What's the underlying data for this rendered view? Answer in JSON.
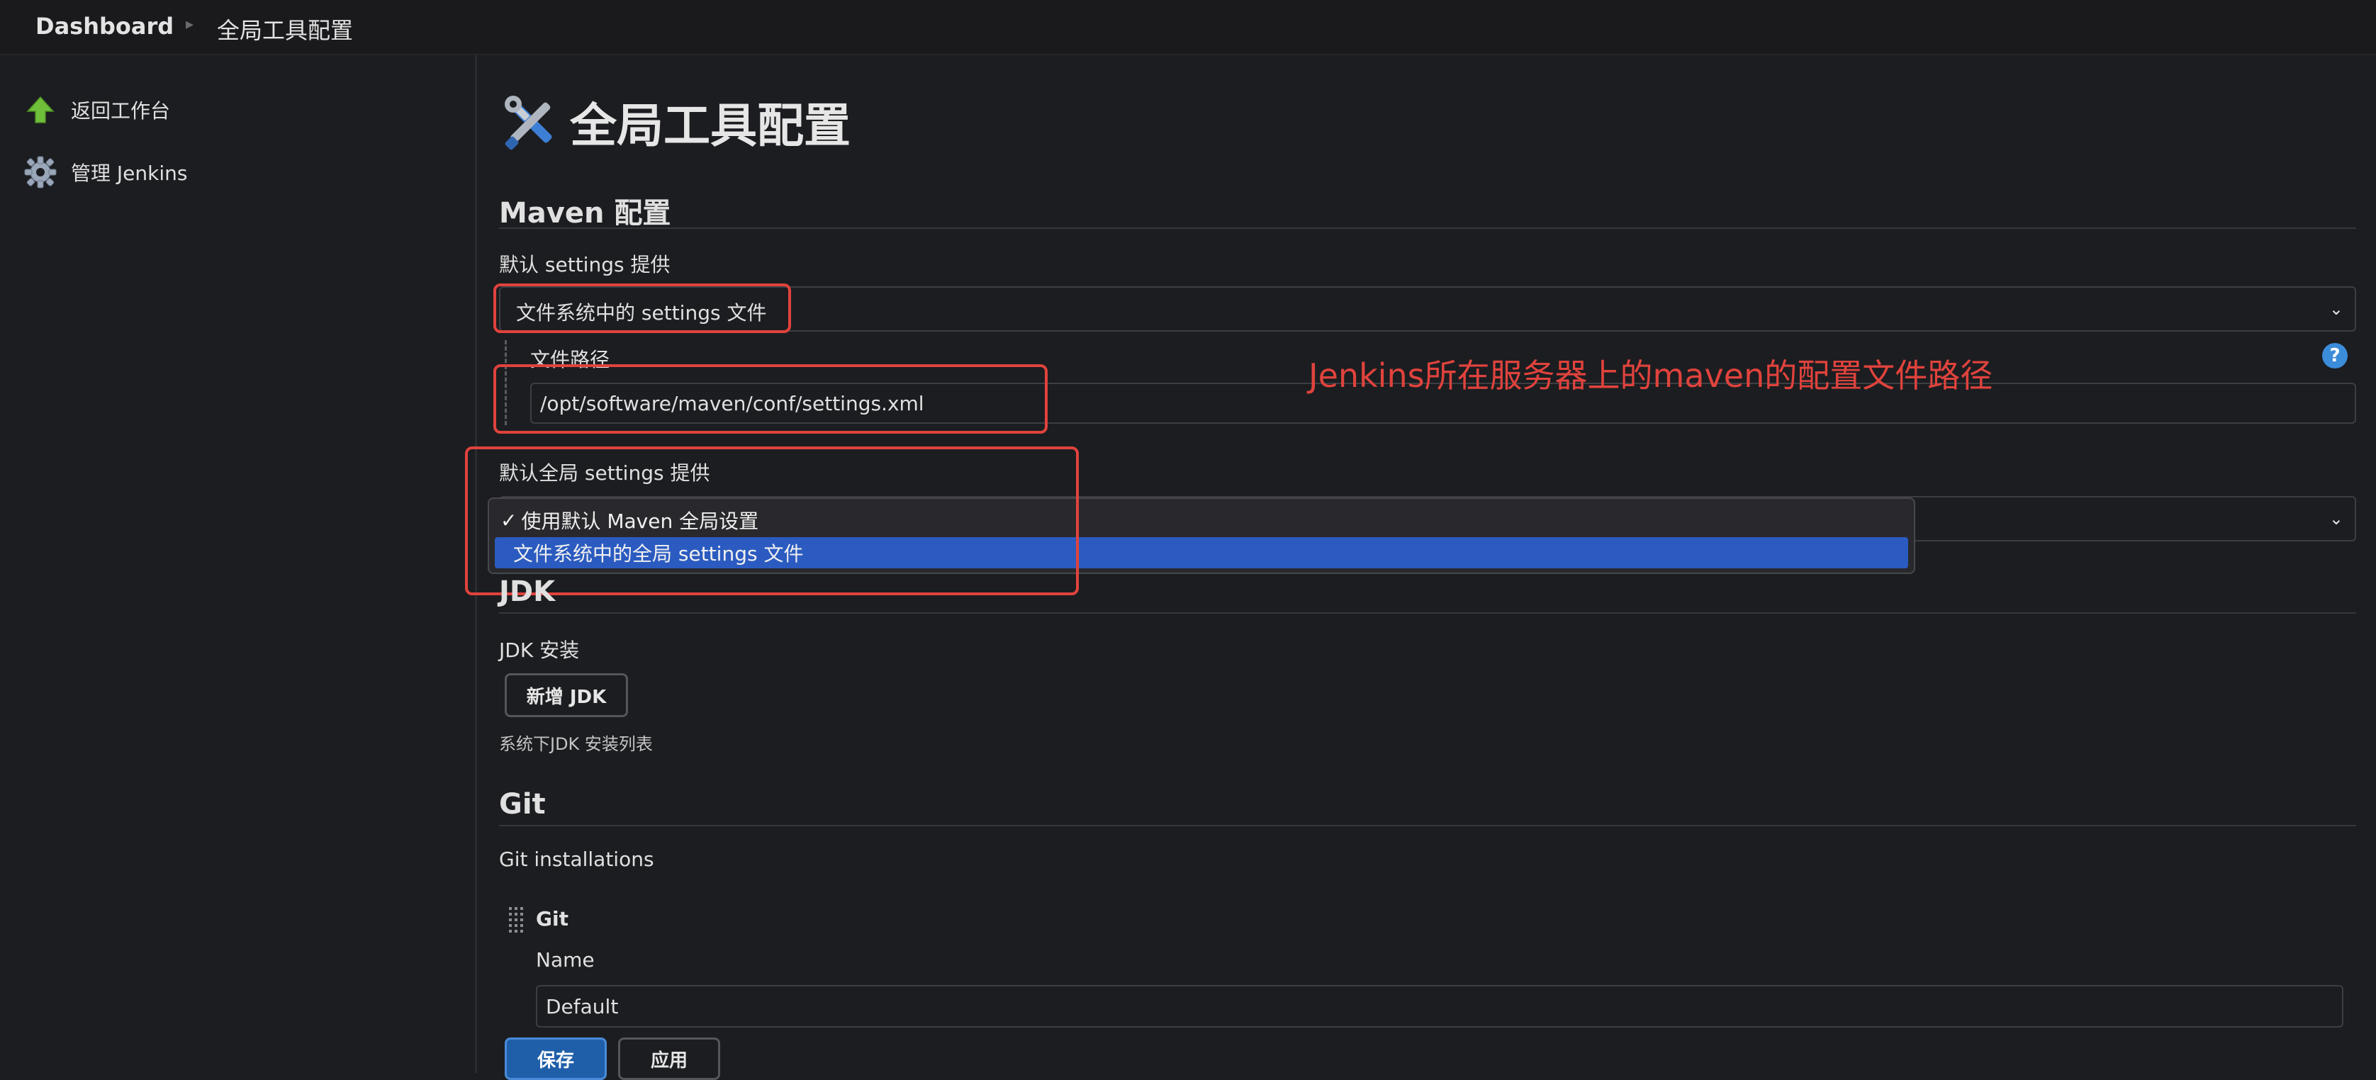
{
  "breadcrumb": {
    "home": "Dashboard",
    "separator": "▸",
    "current": "全局工具配置"
  },
  "sidebar": {
    "items": [
      {
        "label": "返回工作台",
        "icon": "up-arrow-icon"
      },
      {
        "label": "管理 Jenkins",
        "icon": "gear-icon"
      }
    ]
  },
  "page": {
    "title": "全局工具配置",
    "title_icon": "tools-icon"
  },
  "maven": {
    "heading": "Maven 配置",
    "settings_label": "默认 settings 提供",
    "settings_selected": "文件系统中的 settings 文件",
    "file_path_label": "文件路径",
    "file_path_value": "/opt/software/maven/conf/settings.xml",
    "global_settings_label": "默认全局 settings 提供",
    "global_options": [
      {
        "label": "使用默认 Maven 全局设置",
        "checked": true
      },
      {
        "label": "文件系统中的全局 settings 文件",
        "highlighted": true
      }
    ],
    "checkmark": "✓",
    "help_icon": "?"
  },
  "annotation": {
    "text": "Jenkins所在服务器上的maven的配置文件路径",
    "color": "#e0433d"
  },
  "jdk": {
    "heading": "JDK",
    "install_label": "JDK 安装",
    "add_button": "新增 JDK",
    "hint": "系统下JDK 安装列表"
  },
  "git": {
    "heading": "Git",
    "installations_label": "Git installations",
    "item_title": "Git",
    "name_label": "Name",
    "name_value": "Default"
  },
  "footer": {
    "save": "保存",
    "apply": "应用"
  },
  "colors": {
    "background": "#1c1d20",
    "accent": "#1f5ea8",
    "highlight": "#2b5bc0",
    "annotation": "#e0433d"
  }
}
